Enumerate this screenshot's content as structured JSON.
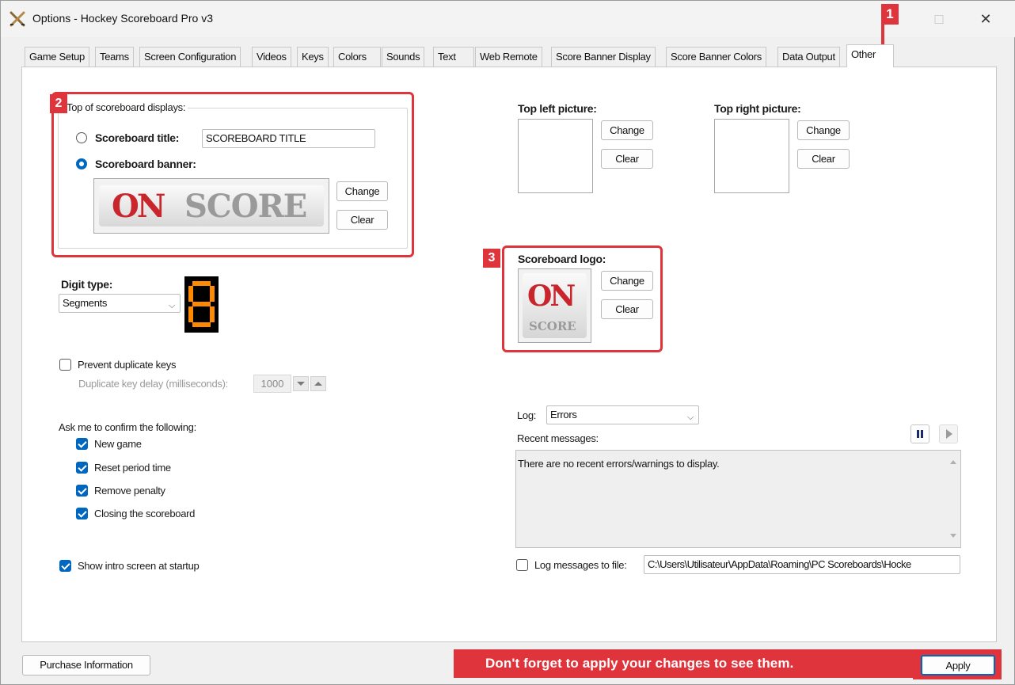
{
  "window": {
    "title": "Options - Hockey Scoreboard Pro v3",
    "minimize": "—",
    "maximize": "□",
    "close": "✕"
  },
  "tabs": [
    {
      "label": "Game Setup"
    },
    {
      "label": "Teams"
    },
    {
      "label": "Screen Configuration"
    },
    {
      "label": "Videos"
    },
    {
      "label": "Keys"
    },
    {
      "label": "Colors"
    },
    {
      "label": "Sounds"
    },
    {
      "label": "Text"
    },
    {
      "label": "Web Remote"
    },
    {
      "label": "Score Banner Display"
    },
    {
      "label": "Score Banner Colors"
    },
    {
      "label": "Data Output"
    },
    {
      "label": "Other",
      "active": true
    }
  ],
  "top_displays": {
    "legend": "Top of scoreboard displays:",
    "title_label": "Scoreboard title:",
    "title_value": "SCOREBOARD TITLE",
    "banner_label": "Scoreboard banner:",
    "selected": "banner",
    "banner_logo_on": "ON",
    "banner_logo_score": "SCORE",
    "change_label": "Change",
    "clear_label": "Clear"
  },
  "top_left_picture": {
    "label": "Top left picture:",
    "change_label": "Change",
    "clear_label": "Clear"
  },
  "top_right_picture": {
    "label": "Top right picture:",
    "change_label": "Change",
    "clear_label": "Clear"
  },
  "scoreboard_logo": {
    "label": "Scoreboard logo:",
    "logo_on": "ON",
    "logo_score": "SCORE",
    "change_label": "Change",
    "clear_label": "Clear"
  },
  "digit_type": {
    "label": "Digit type:",
    "value": "Segments",
    "preview": "8"
  },
  "duplicate_keys": {
    "label": "Prevent duplicate keys",
    "checked": false,
    "delay_label": "Duplicate key delay (milliseconds):",
    "delay_value": "1000"
  },
  "confirm": {
    "label": "Ask me to confirm the following:",
    "items": [
      {
        "label": "New game",
        "checked": true
      },
      {
        "label": "Reset period time",
        "checked": true
      },
      {
        "label": "Remove penalty",
        "checked": true
      },
      {
        "label": "Closing the scoreboard",
        "checked": true
      }
    ]
  },
  "intro_screen": {
    "label": "Show intro screen at startup",
    "checked": true
  },
  "log": {
    "label": "Log:",
    "value": "Errors",
    "recent_label": "Recent messages:",
    "message": "There are no recent errors/warnings to display.",
    "to_file_label": "Log messages to file:",
    "to_file_checked": false,
    "path": "C:\\Users\\Utilisateur\\AppData\\Roaming\\PC Scoreboards\\Hocke"
  },
  "footer": {
    "purchase_label": "Purchase Information",
    "note": "Don't forget to apply your changes to see them.",
    "apply_label": "Apply"
  },
  "callouts": {
    "one": "1",
    "two": "2",
    "three": "3"
  },
  "colors": {
    "accent": "#0067c0",
    "callout": "#e0343c",
    "digit": "#ff8a00"
  },
  "icons": {
    "app": "crossed-sticks-icon",
    "pause": "pause-icon",
    "play": "play-icon"
  }
}
